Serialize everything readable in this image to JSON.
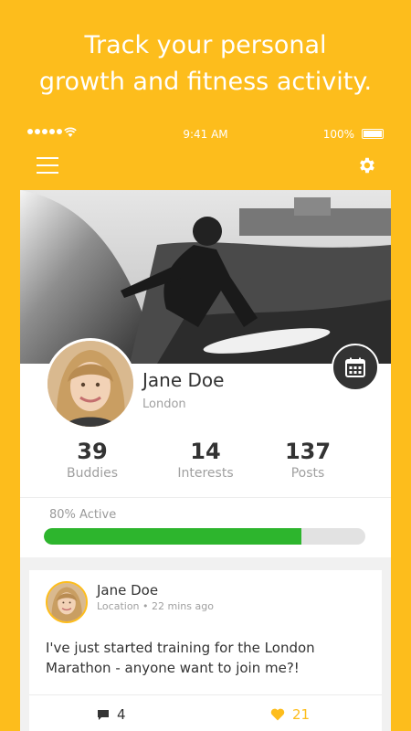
{
  "headline": {
    "line1": "Track your personal",
    "line2": "growth and fitness activity."
  },
  "status_bar": {
    "time": "9:41 AM",
    "battery": "100%"
  },
  "nav": {
    "menu_icon": "hamburger-icon",
    "settings_icon": "gear-icon"
  },
  "profile": {
    "name": "Jane Doe",
    "location": "London",
    "calendar_icon": "calendar-icon"
  },
  "stats": [
    {
      "value": "39",
      "label": "Buddies"
    },
    {
      "value": "14",
      "label": "Interests"
    },
    {
      "value": "137",
      "label": "Posts"
    }
  ],
  "activity": {
    "label": "80% Active",
    "progress": 0.8,
    "color": "#2DB52D"
  },
  "post": {
    "author": "Jane Doe",
    "location": "Location",
    "time": "22 mins ago",
    "text": "I've just started training for the London Marathon - anyone want to join me?!",
    "comments": "4",
    "likes": "21"
  },
  "colors": {
    "brand": "#FDBD1C"
  }
}
